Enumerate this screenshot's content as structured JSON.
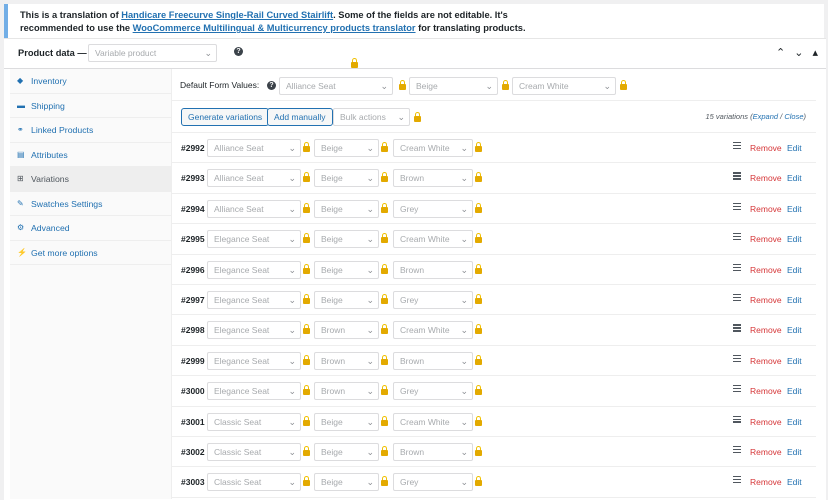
{
  "notice": {
    "line1_pre": "This is a translation of ",
    "line1_link": "Handicare Freecurve Single-Rail Curved Stairlift",
    "line1_post": ". Some of the fields are not editable. It's",
    "line2_pre": "recommended to use the ",
    "line2_link": "WooCommerce Multilingual & Multicurrency products translator",
    "line2_post": " for translating products."
  },
  "product_data": {
    "label": "Product data —",
    "type_value": "Variable product"
  },
  "sidebar": {
    "items": [
      {
        "label": "Inventory",
        "icon": "diamond-icon"
      },
      {
        "label": "Shipping",
        "icon": "truck-icon"
      },
      {
        "label": "Linked Products",
        "icon": "link-icon"
      },
      {
        "label": "Attributes",
        "icon": "list-icon"
      },
      {
        "label": "Variations",
        "icon": "grid-icon"
      },
      {
        "label": "Swatches Settings",
        "icon": "wrench-icon"
      },
      {
        "label": "Advanced",
        "icon": "gear-icon"
      },
      {
        "label": "Get more options",
        "icon": "plug-icon"
      }
    ]
  },
  "default_form": {
    "label": "Default Form Values:",
    "seat": "Alliance Seat",
    "color": "Beige",
    "rail": "Cream White"
  },
  "toolbar": {
    "generate": "Generate variations",
    "add_manually": "Add manually",
    "bulk_actions": "Bulk actions",
    "count_text": "15 variations (",
    "expand": "Expand",
    "sep": " / ",
    "close": "Close",
    "count_end": ")"
  },
  "variations": [
    {
      "id": "#2992",
      "seat": "Alliance Seat",
      "color": "Beige",
      "rail": "Cream White"
    },
    {
      "id": "#2993",
      "seat": "Alliance Seat",
      "color": "Beige",
      "rail": "Brown"
    },
    {
      "id": "#2994",
      "seat": "Alliance Seat",
      "color": "Beige",
      "rail": "Grey"
    },
    {
      "id": "#2995",
      "seat": "Elegance Seat",
      "color": "Beige",
      "rail": "Cream White"
    },
    {
      "id": "#2996",
      "seat": "Elegance Seat",
      "color": "Beige",
      "rail": "Brown"
    },
    {
      "id": "#2997",
      "seat": "Elegance Seat",
      "color": "Beige",
      "rail": "Grey"
    },
    {
      "id": "#2998",
      "seat": "Elegance Seat",
      "color": "Brown",
      "rail": "Cream White"
    },
    {
      "id": "#2999",
      "seat": "Elegance Seat",
      "color": "Brown",
      "rail": "Brown"
    },
    {
      "id": "#3000",
      "seat": "Elegance Seat",
      "color": "Brown",
      "rail": "Grey"
    },
    {
      "id": "#3001",
      "seat": "Classic Seat",
      "color": "Beige",
      "rail": "Cream White"
    },
    {
      "id": "#3002",
      "seat": "Classic Seat",
      "color": "Beige",
      "rail": "Brown"
    },
    {
      "id": "#3003",
      "seat": "Classic Seat",
      "color": "Beige",
      "rail": "Grey"
    }
  ],
  "row_actions": {
    "remove": "Remove",
    "edit": "Edit"
  },
  "colors": {
    "link": "#2271b1",
    "remove": "#d63638",
    "lock": "#e3aa00"
  }
}
